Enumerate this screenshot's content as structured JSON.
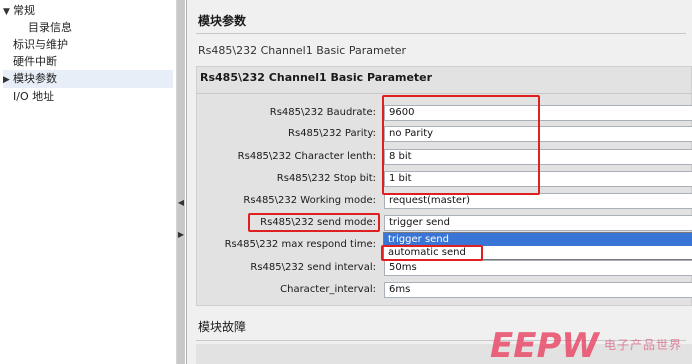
{
  "nav": {
    "items": [
      {
        "label": "常规",
        "expanded": true
      },
      {
        "label": "目录信息"
      },
      {
        "label": "标识与维护"
      },
      {
        "label": "硬件中断"
      },
      {
        "label": "模块参数",
        "selected": true
      },
      {
        "label": "I/O 地址"
      }
    ]
  },
  "main": {
    "section_title": "模块参数",
    "sub_title": "Rs485\\232 Channel1 Basic Parameter",
    "group_title": "Rs485\\232 Channel1 Basic Parameter",
    "rows": [
      {
        "label": "Rs485\\232  Baudrate:",
        "value": "9600"
      },
      {
        "label": "Rs485\\232  Parity:",
        "value": "no Parity"
      },
      {
        "label": "Rs485\\232  Character lenth:",
        "value": "8 bit"
      },
      {
        "label": "Rs485\\232 Stop bit:",
        "value": "1 bit"
      },
      {
        "label": "Rs485\\232 Working mode:",
        "value": "request(master)"
      },
      {
        "label": "Rs485\\232 send mode:",
        "value": "trigger send"
      },
      {
        "label": "Rs485\\232 max respond time:",
        "value": ""
      },
      {
        "label": "Rs485\\232 send interval:",
        "value": "50ms"
      },
      {
        "label": "Character_interval:",
        "value": "6ms"
      }
    ],
    "dropdown_options": [
      "trigger send",
      "automatic send"
    ],
    "bottom_title": "模块故障"
  },
  "watermark": {
    "logo": "EEPW",
    "caption": "电子产品世界"
  },
  "colors": {
    "highlight_red": "#e02020",
    "selection_blue": "#3875d7",
    "panel_gray": "#e2e2e2"
  }
}
